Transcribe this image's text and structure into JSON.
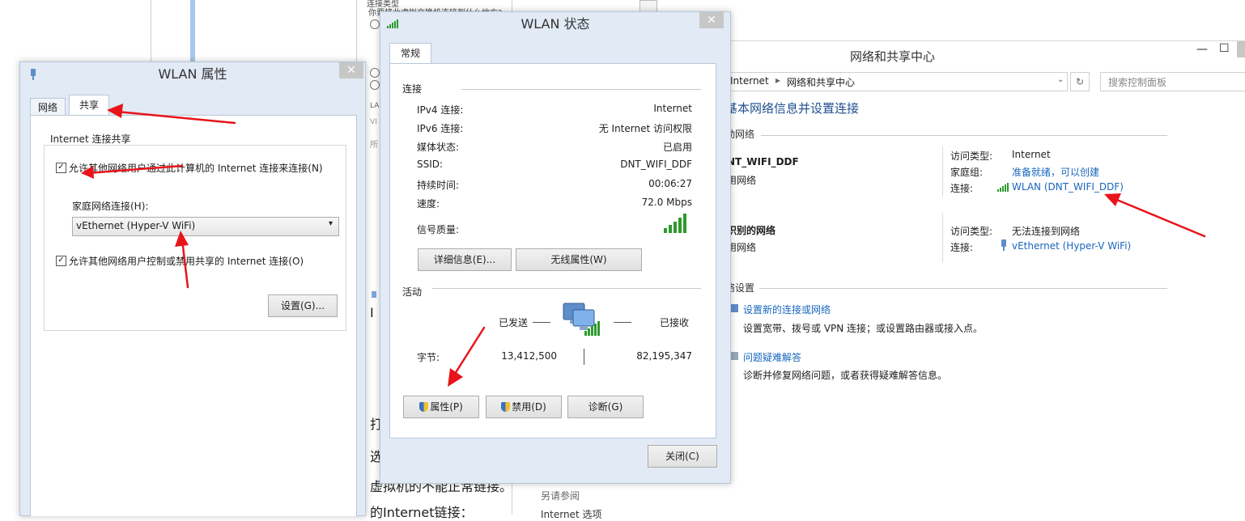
{
  "background": {
    "top_text_1": "连接类型",
    "top_text_2": "你要将此虚拟交换机连接到什么地方?",
    "left_fragment_1": "I",
    "left_fragment_2": "打",
    "left_fragment_3": "选",
    "bottom_text_1": "虚拟机的不能正常链接。",
    "bottom_text_2": "的Internet链接：",
    "see_also": "另请参阅",
    "bottom_item": "Internet 选项",
    "frag_la": "LA",
    "frag_vi": "VI",
    "frag_suo": "所"
  },
  "network_center": {
    "title": "网络和共享中心",
    "minimize_glyph": "—",
    "maximize_glyph": "☐",
    "breadcrumb": [
      "Internet",
      "网络和共享中心"
    ],
    "search_placeholder": "搜索控制面板",
    "heading": "基本网络信息并设置连接",
    "active_networks": "动网络",
    "network1": {
      "name": "NT_WIFI_DDF",
      "category": "用网络",
      "access_type_label": "访问类型:",
      "access_type_value": "Internet",
      "homegroup_label": "家庭组:",
      "homegroup_value": "准备就绪，可以创建",
      "connection_label": "连接:",
      "connection_value": "WLAN (DNT_WIFI_DDF)"
    },
    "network2": {
      "name": "识别的网络",
      "category": "用网络",
      "access_type_label": "访问类型:",
      "access_type_value": "无法连接到网络",
      "connection_label": "连接:",
      "connection_value": "vEthernet (Hyper-V WiFi)"
    },
    "change_settings": "络设置",
    "setup_link": "设置新的连接或网络",
    "setup_desc": "设置宽带、拨号或 VPN 连接；或设置路由器或接入点。",
    "troubleshoot_link": "问题疑难解答",
    "troubleshoot_desc": "诊断并修复网络问题，或者获得疑难解答信息。"
  },
  "wlan_status": {
    "title": "WLAN 状态",
    "tab": "常规",
    "connection_section": "连接",
    "rows": [
      {
        "label": "IPv4 连接:",
        "value": "Internet"
      },
      {
        "label": "IPv6 连接:",
        "value": "无 Internet 访问权限"
      },
      {
        "label": "媒体状态:",
        "value": "已启用"
      },
      {
        "label": "SSID:",
        "value": "DNT_WIFI_DDF"
      },
      {
        "label": "持续时间:",
        "value": "00:06:27"
      },
      {
        "label": "速度:",
        "value": "72.0 Mbps"
      }
    ],
    "signal_label": "信号质量:",
    "signal_bars": 5,
    "details_button": "详细信息(E)...",
    "wireless_props_button": "无线属性(W)",
    "activity_section": "活动",
    "sent_label": "已发送",
    "received_label": "已接收",
    "bytes_label": "字节:",
    "bytes_sent": "13,412,500",
    "bytes_received": "82,195,347",
    "properties_button": "属性(P)",
    "disable_button": "禁用(D)",
    "diagnose_button": "诊断(G)",
    "close_button": "关闭(C)"
  },
  "wlan_properties": {
    "title": "WLAN 属性",
    "tabs": [
      "网络",
      "共享"
    ],
    "group_title": "Internet 连接共享",
    "allow_share_label": "允许其他网络用户通过此计算机的 Internet 连接来连接(N)",
    "allow_share_checked": true,
    "home_connection_label": "家庭网络连接(H):",
    "home_connection_value": "vEthernet (Hyper-V WiFi)",
    "allow_control_label": "允许其他网络用户控制或禁用共享的 Internet 连接(O)",
    "allow_control_checked": true,
    "settings_button": "设置(G)..."
  },
  "colors": {
    "accent_link": "#1866bd",
    "annotation_red": "#e8141a",
    "signal_green": "#2f9a2f"
  },
  "icons": {
    "close": "close-icon",
    "signal": "wifi-signal-icon",
    "shield": "uac-shield-icon",
    "network": "network-computers-icon",
    "adapter": "network-adapter-icon",
    "refresh": "refresh-icon"
  }
}
